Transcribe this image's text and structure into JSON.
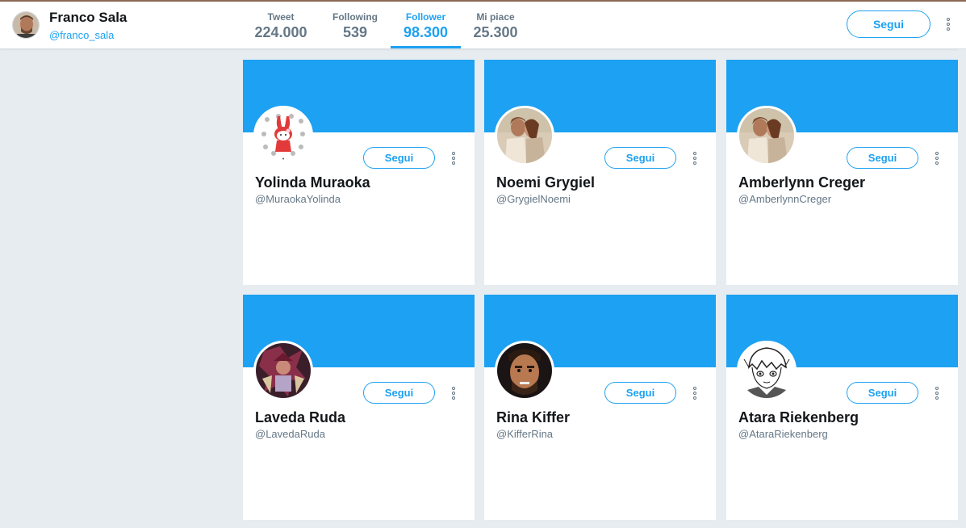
{
  "profile": {
    "name": "Franco Sala",
    "handle": "@franco_sala"
  },
  "stats": [
    {
      "label": "Tweet",
      "value": "224.000",
      "active": false
    },
    {
      "label": "Following",
      "value": "539",
      "active": false
    },
    {
      "label": "Follower",
      "value": "98.300",
      "active": true
    },
    {
      "label": "Mi piace",
      "value": "25.300",
      "active": false
    }
  ],
  "header": {
    "follow_label": "Segui",
    "more_icon": "more-vertical-icon"
  },
  "colors": {
    "accent": "#1da1f2",
    "background": "#e6ecf0",
    "text": "#14171a",
    "muted": "#657786"
  },
  "followers": [
    {
      "name": "Yolinda Muraoka",
      "handle": "@MuraokaYolinda",
      "follow_label": "Segui",
      "avatar": "cartoon-rabbit"
    },
    {
      "name": "Noemi Grygiel",
      "handle": "@GrygielNoemi",
      "follow_label": "Segui",
      "avatar": "couple-photo"
    },
    {
      "name": "Amberlynn Creger",
      "handle": "@AmberlynnCreger",
      "follow_label": "Segui",
      "avatar": "couple-photo"
    },
    {
      "name": "Laveda Ruda",
      "handle": "@LavedaRuda",
      "follow_label": "Segui",
      "avatar": "armored-warrior"
    },
    {
      "name": "Rina Kiffer",
      "handle": "@KifferRina",
      "follow_label": "Segui",
      "avatar": "bearded-man"
    },
    {
      "name": "Atara Riekenberg",
      "handle": "@AtaraRiekenberg",
      "follow_label": "Segui",
      "avatar": "manga-sketch"
    }
  ]
}
